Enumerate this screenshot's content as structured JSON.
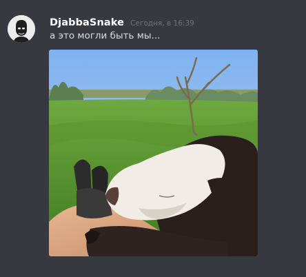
{
  "message": {
    "username": "DjabbaSnake",
    "timestamp": "Сегодня, в 16:39",
    "text": "а это могли быть мы...",
    "avatar_icon": "user-avatar-icon",
    "attachment_icon": "image-attachment-icon"
  },
  "colors": {
    "background": "#36393f",
    "username": "#ffffff",
    "timestamp": "#72767d",
    "text": "#dcddde"
  }
}
